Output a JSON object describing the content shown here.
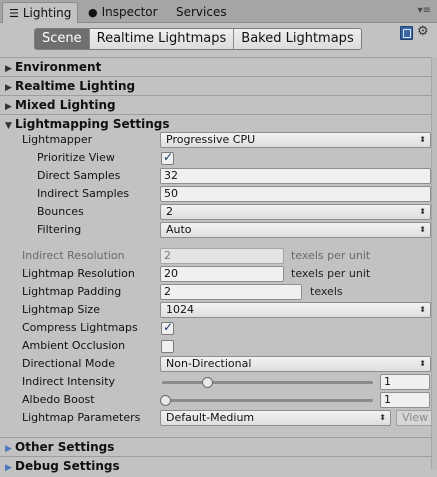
{
  "tabs": [
    {
      "label": "Lighting",
      "icon": "lighting-tab-icon"
    },
    {
      "label": "Inspector",
      "icon": "info-icon"
    },
    {
      "label": "Services"
    }
  ],
  "tab_menu_glyph": "▾≡",
  "modes": [
    "Scene",
    "Realtime Lightmaps",
    "Baked Lightmaps"
  ],
  "active_mode": "Scene",
  "sections": {
    "environment": "Environment",
    "realtime_lighting": "Realtime Lighting",
    "mixed_lighting": "Mixed Lighting",
    "lightmapping_settings": "Lightmapping Settings",
    "other_settings": "Other Settings",
    "debug_settings": "Debug Settings"
  },
  "lightmapping": {
    "lightmapper": {
      "label": "Lightmapper",
      "value": "Progressive CPU"
    },
    "prioritize_view": {
      "label": "Prioritize View",
      "checked": true
    },
    "direct_samples": {
      "label": "Direct Samples",
      "value": "32"
    },
    "indirect_samples": {
      "label": "Indirect Samples",
      "value": "50"
    },
    "bounces": {
      "label": "Bounces",
      "value": "2"
    },
    "filtering": {
      "label": "Filtering",
      "value": "Auto"
    },
    "indirect_resolution": {
      "label": "Indirect Resolution",
      "value": "2",
      "unit": "texels per unit"
    },
    "lightmap_resolution": {
      "label": "Lightmap Resolution",
      "value": "20",
      "unit": "texels per unit"
    },
    "lightmap_padding": {
      "label": "Lightmap Padding",
      "value": "2",
      "unit": "texels"
    },
    "lightmap_size": {
      "label": "Lightmap Size",
      "value": "1024"
    },
    "compress_lightmaps": {
      "label": "Compress Lightmaps",
      "checked": true
    },
    "ambient_occlusion": {
      "label": "Ambient Occlusion",
      "checked": false
    },
    "directional_mode": {
      "label": "Directional Mode",
      "value": "Non-Directional"
    },
    "indirect_intensity": {
      "label": "Indirect Intensity",
      "value": "1",
      "slider_fraction": 0.2
    },
    "albedo_boost": {
      "label": "Albedo Boost",
      "value": "1",
      "slider_fraction": 0.0
    },
    "lightmap_parameters": {
      "label": "Lightmap Parameters",
      "value": "Default-Medium",
      "button": "View"
    }
  },
  "colors": {
    "accent_check": "#1f3a66",
    "active_mode_bg": "#6f6f6f",
    "foldout_blue": "#4a78c0"
  }
}
